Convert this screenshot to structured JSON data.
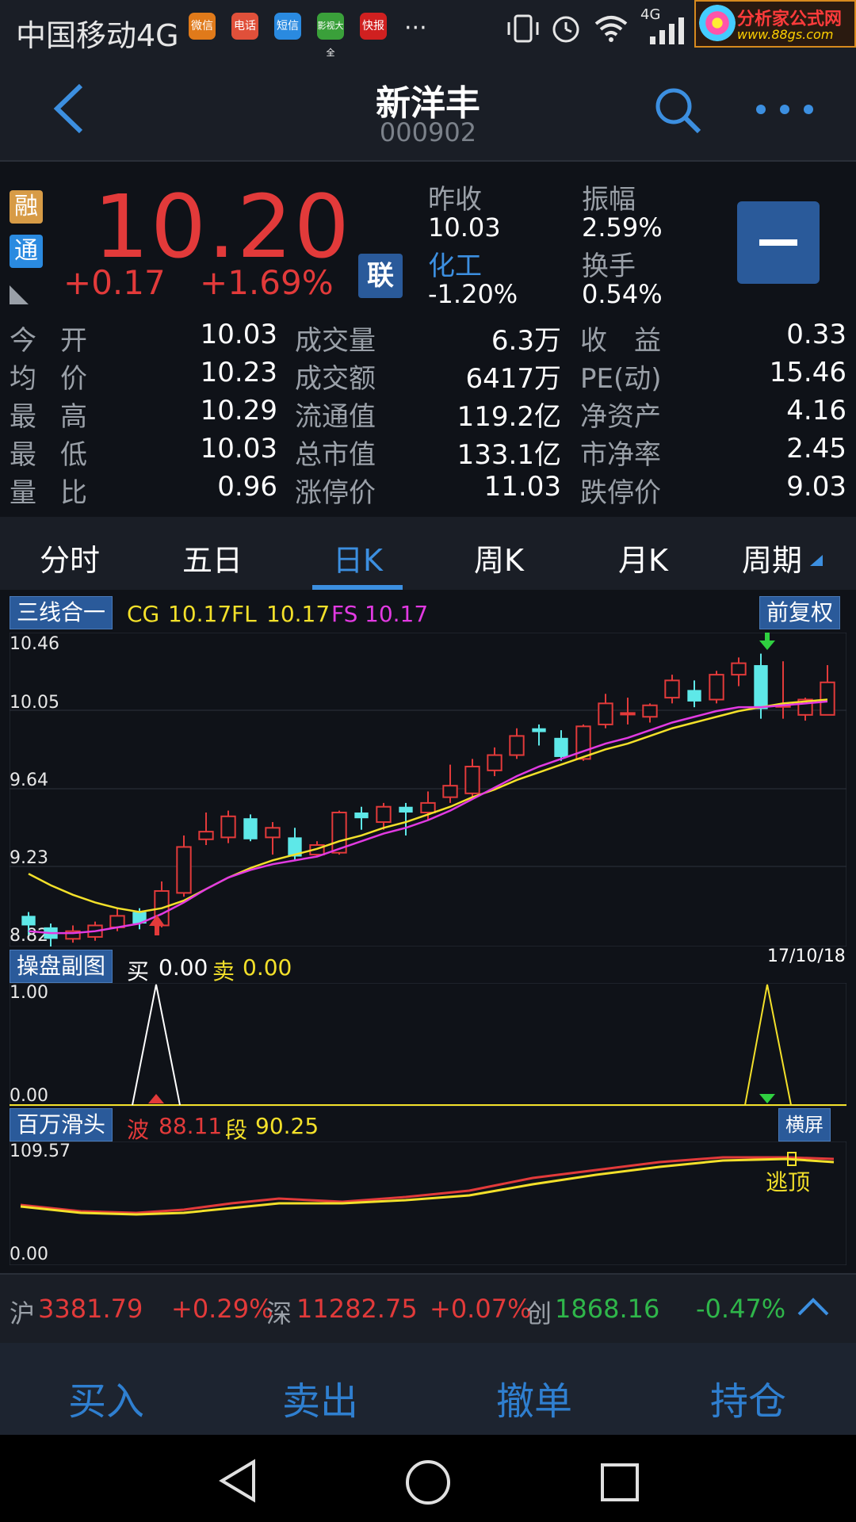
{
  "status_bar": {
    "carrier": "中国移动4G",
    "network": "4G",
    "app_icons": [
      "微信",
      "电话",
      "短信",
      "影视大全",
      "快报"
    ],
    "more": "···",
    "ad": {
      "title": "分析家公式网",
      "url": "www.88gs.com"
    }
  },
  "header": {
    "stock_name": "新洋丰",
    "stock_code": "000902"
  },
  "quote": {
    "badges": [
      "融",
      "通"
    ],
    "price": "10.20",
    "change": "+0.17",
    "change_pct": "+1.69%",
    "lian_label": "联",
    "prev_close_label": "昨收",
    "prev_close": "10.03",
    "amplitude_label": "振幅",
    "amplitude": "2.59%",
    "sector_label": "化工",
    "sector_change": "-1.20%",
    "turnover_label": "换手",
    "turnover": "0.54%"
  },
  "metrics": [
    {
      "l1": "今开",
      "v1": "10.03",
      "l2": "成交量",
      "v2": "6.3万",
      "l3": "收　益",
      "v3": "0.33"
    },
    {
      "l1": "均价",
      "v1": "10.23",
      "l2": "成交额",
      "v2": "6417万",
      "l3": "PE(动)",
      "v3": "15.46"
    },
    {
      "l1": "最高",
      "v1": "10.29",
      "l2": "流通值",
      "v2": "119.2亿",
      "l3": "净资产",
      "v3": "4.16"
    },
    {
      "l1": "最低",
      "v1": "10.03",
      "l2": "总市值",
      "v2": "133.1亿",
      "l3": "市净率",
      "v3": "2.45"
    },
    {
      "l1": "量比",
      "v1": "0.96",
      "l2": "涨停价",
      "v2": "11.03",
      "l3": "跌停价",
      "v3": "9.03"
    }
  ],
  "tabs": [
    {
      "label": "分时"
    },
    {
      "label": "五日"
    },
    {
      "label": "日K"
    },
    {
      "label": "周K"
    },
    {
      "label": "月K"
    },
    {
      "label": "周期"
    }
  ],
  "main_panel": {
    "label": "三线合一",
    "adjust_label": "前复权",
    "indicators": [
      {
        "name": "CG",
        "value": "10.17"
      },
      {
        "name": "FL",
        "value": "10.17"
      },
      {
        "name": "FS",
        "value": "10.17"
      }
    ],
    "y_labels": [
      "10.46",
      "10.05",
      "9.64",
      "9.23",
      "8.82"
    ]
  },
  "sub_panel": {
    "label": "操盘副图",
    "buy_label": "买",
    "buy_value": "0.00",
    "sell_label": "卖",
    "sell_value": "0.00",
    "date": "17/10/18",
    "y_labels": [
      "1.00",
      "0.00"
    ]
  },
  "third_panel": {
    "label": "百万滑头",
    "wave_label": "波",
    "wave_value": "88.11",
    "segment_label": "段",
    "segment_value": "90.25",
    "landscape_label": "横屏",
    "y_labels": [
      "109.57",
      "0.00"
    ],
    "signal_label": "逃顶"
  },
  "chart_data": {
    "type": "candlestick",
    "ylim": [
      8.82,
      10.46
    ],
    "candles": [
      {
        "o": 8.98,
        "c": 8.93,
        "h": 9.0,
        "l": 8.88
      },
      {
        "o": 8.92,
        "c": 8.86,
        "h": 8.94,
        "l": 8.8
      },
      {
        "o": 8.86,
        "c": 8.9,
        "h": 8.93,
        "l": 8.84
      },
      {
        "o": 8.87,
        "c": 8.93,
        "h": 8.95,
        "l": 8.85
      },
      {
        "o": 8.92,
        "c": 8.98,
        "h": 9.02,
        "l": 8.9
      },
      {
        "o": 9.0,
        "c": 8.94,
        "h": 9.02,
        "l": 8.91
      },
      {
        "o": 8.93,
        "c": 9.11,
        "h": 9.16,
        "l": 8.92
      },
      {
        "o": 9.1,
        "c": 9.34,
        "h": 9.4,
        "l": 9.08
      },
      {
        "o": 9.38,
        "c": 9.42,
        "h": 9.52,
        "l": 9.35
      },
      {
        "o": 9.39,
        "c": 9.5,
        "h": 9.53,
        "l": 9.36
      },
      {
        "o": 9.49,
        "c": 9.38,
        "h": 9.51,
        "l": 9.37
      },
      {
        "o": 9.39,
        "c": 9.44,
        "h": 9.47,
        "l": 9.3
      },
      {
        "o": 9.39,
        "c": 9.29,
        "h": 9.44,
        "l": 9.27
      },
      {
        "o": 9.3,
        "c": 9.35,
        "h": 9.37,
        "l": 9.29
      },
      {
        "o": 9.31,
        "c": 9.52,
        "h": 9.53,
        "l": 9.3
      },
      {
        "o": 9.52,
        "c": 9.49,
        "h": 9.55,
        "l": 9.43
      },
      {
        "o": 9.47,
        "c": 9.55,
        "h": 9.57,
        "l": 9.43
      },
      {
        "o": 9.55,
        "c": 9.52,
        "h": 9.57,
        "l": 9.4
      },
      {
        "o": 9.52,
        "c": 9.57,
        "h": 9.63,
        "l": 9.48
      },
      {
        "o": 9.6,
        "c": 9.66,
        "h": 9.77,
        "l": 9.57
      },
      {
        "o": 9.62,
        "c": 9.76,
        "h": 9.8,
        "l": 9.6
      },
      {
        "o": 9.74,
        "c": 9.82,
        "h": 9.86,
        "l": 9.71
      },
      {
        "o": 9.82,
        "c": 9.92,
        "h": 9.96,
        "l": 9.8
      },
      {
        "o": 9.96,
        "c": 9.94,
        "h": 9.98,
        "l": 9.87
      },
      {
        "o": 9.91,
        "c": 9.81,
        "h": 9.95,
        "l": 9.79
      },
      {
        "o": 9.8,
        "c": 9.97,
        "h": 9.98,
        "l": 9.79
      },
      {
        "o": 9.98,
        "c": 10.09,
        "h": 10.14,
        "l": 9.96
      },
      {
        "o": 10.04,
        "c": 10.04,
        "h": 10.12,
        "l": 9.98
      },
      {
        "o": 10.02,
        "c": 10.08,
        "h": 10.09,
        "l": 9.99
      },
      {
        "o": 10.12,
        "c": 10.21,
        "h": 10.24,
        "l": 10.09
      },
      {
        "o": 10.16,
        "c": 10.1,
        "h": 10.21,
        "l": 10.07
      },
      {
        "o": 10.11,
        "c": 10.24,
        "h": 10.26,
        "l": 10.09
      },
      {
        "o": 10.24,
        "c": 10.3,
        "h": 10.33,
        "l": 10.18
      },
      {
        "o": 10.29,
        "c": 10.06,
        "h": 10.35,
        "l": 10.01
      },
      {
        "o": 10.08,
        "c": 10.08,
        "h": 10.31,
        "l": 10.01
      },
      {
        "o": 10.03,
        "c": 10.11,
        "h": 10.12,
        "l": 10.0
      },
      {
        "o": 10.03,
        "c": 10.2,
        "h": 10.29,
        "l": 10.03
      }
    ],
    "series": [
      {
        "name": "CG",
        "color": "#f3e02a",
        "values": [
          9.2,
          9.14,
          9.09,
          9.05,
          9.02,
          9.0,
          9.02,
          9.06,
          9.12,
          9.18,
          9.23,
          9.27,
          9.3,
          9.33,
          9.37,
          9.4,
          9.44,
          9.47,
          9.51,
          9.55,
          9.6,
          9.64,
          9.69,
          9.73,
          9.77,
          9.81,
          9.85,
          9.88,
          9.92,
          9.96,
          9.99,
          10.02,
          10.05,
          10.07,
          10.09,
          10.1,
          10.11
        ]
      },
      {
        "name": "FS",
        "color": "#e23ae2",
        "values": [
          8.9,
          8.89,
          8.89,
          8.9,
          8.92,
          8.94,
          8.99,
          9.05,
          9.12,
          9.18,
          9.22,
          9.25,
          9.27,
          9.29,
          9.33,
          9.37,
          9.41,
          9.44,
          9.48,
          9.53,
          9.59,
          9.65,
          9.71,
          9.76,
          9.8,
          9.84,
          9.88,
          9.91,
          9.95,
          9.99,
          10.02,
          10.05,
          10.07,
          10.07,
          10.08,
          10.09,
          10.1
        ]
      }
    ]
  },
  "ticker": {
    "sh_label": "沪",
    "sh_value": "3381.79",
    "sh_change": "+0.29%",
    "sz_label": "深",
    "sz_value": "11282.75",
    "sz_change": "+0.07%",
    "cy_label": "创",
    "cy_value": "1868.16",
    "cy_change": "-0.47%"
  },
  "actions": [
    {
      "label": "买入"
    },
    {
      "label": "卖出"
    },
    {
      "label": "撤单"
    },
    {
      "label": "持仓"
    }
  ],
  "colors": {
    "up": "#e23a3a",
    "down": "#5ee8e8",
    "accent": "#3c8fe0",
    "panel_label_bg": "#2a5a9a"
  }
}
